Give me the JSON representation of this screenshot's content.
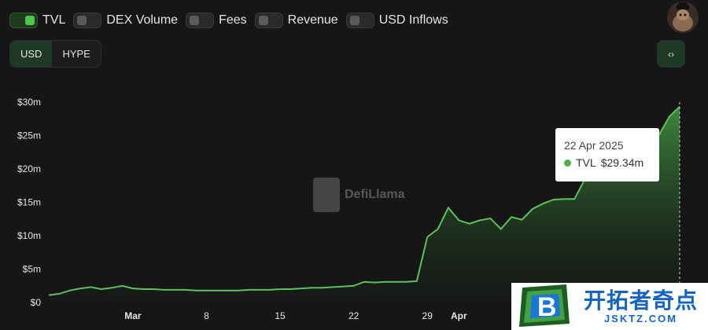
{
  "toggles": [
    {
      "label": "TVL",
      "on": true
    },
    {
      "label": "DEX Volume",
      "on": false
    },
    {
      "label": "Fees",
      "on": false
    },
    {
      "label": "Revenue",
      "on": false
    },
    {
      "label": "USD Inflows",
      "on": false
    }
  ],
  "denomination": {
    "usd_label": "USD",
    "hype_label": "HYPE",
    "active": "USD"
  },
  "embed_label": "‹›",
  "watermark": {
    "text": "DefiLlama"
  },
  "tooltip": {
    "date": "22 Apr 2025",
    "series": "TVL",
    "value": "$29.34m"
  },
  "badge": {
    "title": "开拓者奇点",
    "url": "JSKTZ.COM",
    "logo_letter": "B"
  },
  "colors": {
    "accent": "#4fc44f",
    "line": "#5cc05c",
    "background": "#161616"
  },
  "chart_data": {
    "type": "area",
    "series": [
      {
        "name": "TVL",
        "x": [
          "2025-02-21",
          "2025-02-22",
          "2025-02-23",
          "2025-02-24",
          "2025-02-25",
          "2025-02-26",
          "2025-02-27",
          "2025-02-28",
          "2025-03-01",
          "2025-03-02",
          "2025-03-03",
          "2025-03-04",
          "2025-03-05",
          "2025-03-06",
          "2025-03-07",
          "2025-03-08",
          "2025-03-09",
          "2025-03-10",
          "2025-03-11",
          "2025-03-12",
          "2025-03-13",
          "2025-03-14",
          "2025-03-15",
          "2025-03-16",
          "2025-03-17",
          "2025-03-18",
          "2025-03-19",
          "2025-03-20",
          "2025-03-21",
          "2025-03-22",
          "2025-03-23",
          "2025-03-24",
          "2025-03-25",
          "2025-03-26",
          "2025-03-27",
          "2025-03-28",
          "2025-03-29",
          "2025-03-30",
          "2025-03-31",
          "2025-04-01",
          "2025-04-02",
          "2025-04-03",
          "2025-04-04",
          "2025-04-05",
          "2025-04-06",
          "2025-04-07",
          "2025-04-08",
          "2025-04-09",
          "2025-04-10",
          "2025-04-11",
          "2025-04-12",
          "2025-04-13",
          "2025-04-14",
          "2025-04-15",
          "2025-04-16",
          "2025-04-17",
          "2025-04-18",
          "2025-04-19",
          "2025-04-20",
          "2025-04-21",
          "2025-04-22"
        ],
        "values": [
          1.1,
          1.3,
          1.8,
          2.1,
          2.3,
          2.0,
          2.2,
          2.5,
          2.1,
          2.0,
          2.0,
          1.9,
          1.9,
          1.9,
          1.8,
          1.8,
          1.8,
          1.8,
          1.8,
          1.9,
          1.9,
          1.9,
          2.0,
          2.0,
          2.1,
          2.2,
          2.2,
          2.3,
          2.4,
          2.5,
          3.1,
          3.0,
          3.1,
          3.1,
          3.1,
          3.2,
          9.8,
          11.0,
          14.2,
          12.3,
          11.8,
          12.3,
          12.6,
          11.0,
          12.8,
          12.4,
          14.0,
          14.8,
          15.4,
          15.5,
          15.5,
          18.5,
          19.5,
          19.0,
          20.5,
          21.5,
          22.0,
          24.5,
          25.0,
          27.8,
          29.34
        ]
      }
    ],
    "x_ticks": [
      {
        "date": "2025-03-01",
        "label": "Mar",
        "bold": true
      },
      {
        "date": "2025-03-08",
        "label": "8",
        "bold": false
      },
      {
        "date": "2025-03-15",
        "label": "15",
        "bold": false
      },
      {
        "date": "2025-03-22",
        "label": "22",
        "bold": false
      },
      {
        "date": "2025-03-29",
        "label": "29",
        "bold": false
      },
      {
        "date": "2025-04-01",
        "label": "Apr",
        "bold": true
      }
    ],
    "y_ticks": [
      {
        "value": 0,
        "label": "$0"
      },
      {
        "value": 5,
        "label": "$5m"
      },
      {
        "value": 10,
        "label": "$10m"
      },
      {
        "value": 15,
        "label": "$15m"
      },
      {
        "value": 20,
        "label": "$20m"
      },
      {
        "value": 25,
        "label": "$25m"
      },
      {
        "value": 30,
        "label": "$30m"
      }
    ],
    "xlim": [
      "2025-02-21",
      "2025-04-22"
    ],
    "ylim": [
      0,
      30
    ],
    "grid": false,
    "hover_date": "2025-04-22"
  }
}
